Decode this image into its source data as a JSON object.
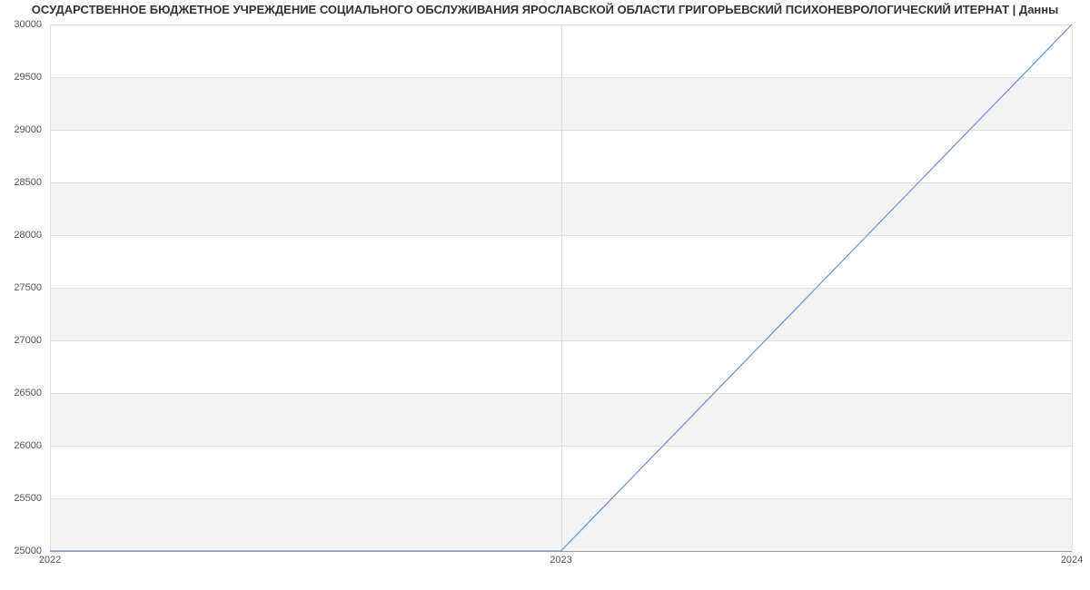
{
  "title": "ОСУДАРСТВЕННОЕ БЮДЖЕТНОЕ УЧРЕЖДЕНИЕ СОЦИАЛЬНОГО ОБСЛУЖИВАНИЯ ЯРОСЛАВСКОЙ ОБЛАСТИ ГРИГОРЬЕВСКИЙ ПСИХОНЕВРОЛОГИЧЕСКИЙ ИТЕРНАТ | Данны",
  "chart_data": {
    "type": "line",
    "x": [
      2022,
      2023,
      2024
    ],
    "series": [
      {
        "name": "series-1",
        "values": [
          25000,
          25000,
          30000
        ],
        "color": "#6a8fd8"
      }
    ],
    "xlabel": "",
    "ylabel": "",
    "xlim": [
      2022,
      2024
    ],
    "ylim": [
      25000,
      30000
    ],
    "y_ticks": [
      25000,
      25500,
      26000,
      26500,
      27000,
      27500,
      28000,
      28500,
      29000,
      29500,
      30000
    ],
    "x_ticks": [
      2022,
      2023,
      2024
    ],
    "grid": true
  }
}
